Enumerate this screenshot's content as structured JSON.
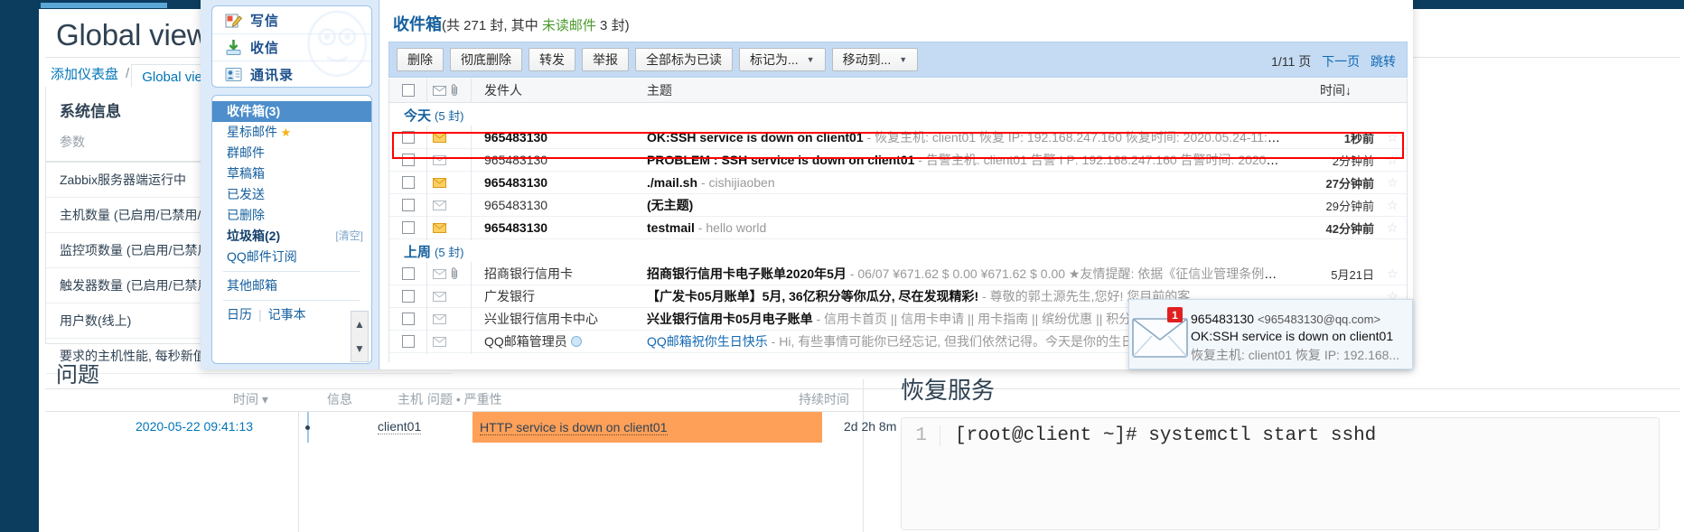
{
  "zabbix": {
    "page_title": "Global view",
    "breadcrumb": {
      "add_dashboard": "添加仪表盘",
      "separator": "/",
      "current": "Global view"
    },
    "system_info": {
      "title": "系统信息",
      "column_header": "参数",
      "rows": [
        "Zabbix服务器端运行中",
        "主机数量 (已启用/已禁用/模板)",
        "监控项数量 (已启用/已禁用/不支持)",
        "触发器数量 (已启用/已禁用 [问题/正常])",
        "用户数(线上)",
        "要求的主机性能, 每秒新值"
      ]
    },
    "problems": {
      "title": "问题",
      "columns": [
        "时间 ▾",
        "信息",
        "主机",
        "问题 • 严重性",
        "持续时间"
      ],
      "rows": [
        {
          "time": "2020-05-22 09:41:13",
          "info": "",
          "host": "client01",
          "problem": "HTTP service is down on client01",
          "duration": "2d 2h 8m",
          "severity_color": "#ffa059"
        }
      ]
    },
    "doc": {
      "heading": "恢复服务",
      "code_line_no": "1",
      "code_text": "[root@client ~]# systemctl start sshd"
    }
  },
  "qqmail": {
    "compose_menu": [
      {
        "icon": "compose-icon",
        "label": "写信"
      },
      {
        "icon": "receive-icon",
        "label": "收信"
      },
      {
        "icon": "contacts-icon",
        "label": "通讯录"
      }
    ],
    "folders": [
      {
        "label": "收件箱(3)",
        "selected": true,
        "bold": true,
        "right": ""
      },
      {
        "label": "星标邮件",
        "star": "★",
        "selected": false,
        "bold": false,
        "right": ""
      },
      {
        "label": "群邮件",
        "selected": false,
        "bold": false,
        "right": ""
      },
      {
        "label": "草稿箱",
        "selected": false,
        "bold": false,
        "right": ""
      },
      {
        "label": "已发送",
        "selected": false,
        "bold": false,
        "right": ""
      },
      {
        "label": "已删除",
        "selected": false,
        "bold": false,
        "right": ""
      },
      {
        "label": "垃圾箱(2)",
        "selected": false,
        "bold": true,
        "right": "[清空]"
      },
      {
        "label": "QQ邮件订阅",
        "selected": false,
        "bold": false,
        "right": ""
      }
    ],
    "other_mailbox": "其他邮箱",
    "tools": {
      "calendar": "日历",
      "sep": "|",
      "notes": "记事本"
    },
    "header": {
      "folder_name": "收件箱",
      "count_prefix": "(共 271 封, 其中 ",
      "unread_label": "未读邮件",
      "count_suffix": " 3 封)"
    },
    "toolbar": {
      "buttons": [
        {
          "label": "删除",
          "caret": false
        },
        {
          "label": "彻底删除",
          "caret": false
        },
        {
          "label": "转发",
          "caret": false
        },
        {
          "label": "举报",
          "caret": false
        },
        {
          "label": "全部标为已读",
          "caret": false
        },
        {
          "label": "标记为...",
          "caret": true
        },
        {
          "label": "移动到...",
          "caret": true
        }
      ],
      "page_indicator": "1/11 页",
      "next_page": "下一页",
      "jump": "跳转"
    },
    "columns": {
      "sender": "发件人",
      "subject": "主题",
      "time": "时间↓"
    },
    "groups": [
      {
        "label": "今天",
        "count": "(5 封)",
        "rows": [
          {
            "sender": "965483130",
            "subject": "OK:SSH service is down on client01",
            "preview": " - 恢复主机: client01 恢复 IP: 192.168.247.160 恢复时间: 2020.05.24-11:47:...",
            "time": "1秒前",
            "unread": true,
            "highlighted": true,
            "envelope": "unread"
          },
          {
            "sender": "965483130",
            "subject": "PROBLEM : SSH service is down on client01",
            "preview": " - 告警主机: client01 告警 I P: 192.168.247.160 告警时间: 2020.05.24 - 1...",
            "time": "2分钟前",
            "unread": false,
            "highlighted": false,
            "envelope": "read"
          },
          {
            "sender": "965483130",
            "subject": "./mail.sh",
            "preview": " - cishijiaoben",
            "time": "27分钟前",
            "unread": true,
            "highlighted": false,
            "envelope": "unread"
          },
          {
            "sender": "965483130",
            "subject": "(无主题)",
            "preview": "",
            "time": "29分钟前",
            "unread": false,
            "highlighted": false,
            "envelope": "read"
          },
          {
            "sender": "965483130",
            "subject": "testmail",
            "preview": " - hello world",
            "time": "42分钟前",
            "unread": true,
            "highlighted": false,
            "envelope": "unread"
          }
        ]
      },
      {
        "label": "上周",
        "count": "(5 封)",
        "rows": [
          {
            "sender": "招商银行信用卡",
            "subject": "招商银行信用卡电子账单2020年5月",
            "preview": " - 06/07 ¥671.62 $ 0.00 ¥671.62 $ 0.00 ★友情提醒: 依据《征信业管理条例》相关规定...",
            "time": "5月21日",
            "unread": false,
            "highlighted": false,
            "envelope": "read",
            "attachment": true
          },
          {
            "sender": "广发银行",
            "subject": "【广发卡05月账单】5月, 36亿积分等你瓜分, 尽在发现精彩!",
            "preview": " - 尊敬的郭土源先生,您好! 您目前的客...",
            "time": "",
            "unread": false,
            "highlighted": false,
            "envelope": "read"
          },
          {
            "sender": "兴业银行信用卡中心",
            "subject": "兴业银行信用卡05月电子账单",
            "preview": " - 信用卡首页 || 信用卡申请 || 用卡指南 || 缤纷优惠 || 积分计划 || 特色专...",
            "time": "",
            "unread": false,
            "highlighted": false,
            "envelope": "read"
          },
          {
            "sender": "QQ邮箱管理员",
            "subject": "QQ邮箱祝你生日快乐",
            "preview": " - Hi, 有些事情可能你已经忘记, 但我们依然记得。今天是你的生日, 我们唱了一首...",
            "time": "",
            "unread": false,
            "highlighted": false,
            "envelope": "read",
            "link": true,
            "verified": true
          }
        ]
      }
    ],
    "toast": {
      "badge": "1",
      "sender": "965483130",
      "address": "<965483130@qq.com>",
      "subject": "OK:SSH service is down on client01",
      "preview": "恢复主机: client01 恢复 IP: 192.168..."
    }
  },
  "colors": {
    "zabbix_dark": "#0c3d5e",
    "accent_blue": "#0275b8",
    "severity_orange": "#ffa059",
    "mail_selected": "#4d8ecb",
    "highlight_red": "#ff0000",
    "unread_green": "#4a9a2a",
    "badge_red": "#e02020"
  }
}
